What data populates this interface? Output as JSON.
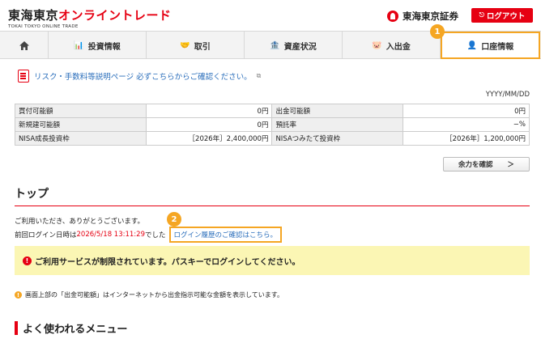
{
  "header": {
    "logo_text_black": "東海東京",
    "logo_text_red": "オンライントレード",
    "logo_sub": "TOKAI TOKYO ONLINE TRADE",
    "brand_name": "東海東京証券",
    "logout_label": "ログアウト"
  },
  "nav": {
    "items": [
      {
        "label": "",
        "icon": "home-icon"
      },
      {
        "label": "投資情報",
        "icon": "chart-icon"
      },
      {
        "label": "取引",
        "icon": "handshake-icon"
      },
      {
        "label": "資産状況",
        "icon": "building-icon"
      },
      {
        "label": "入出金",
        "icon": "piggy-bank-icon"
      },
      {
        "label": "口座情報",
        "icon": "user-icon"
      }
    ]
  },
  "badges": {
    "one": "1",
    "two": "2"
  },
  "risk": {
    "link_text": "リスク・手数料等説明ページ 必ずこちらからご確認ください。"
  },
  "date_label": "YYYY/MM/DD",
  "account": {
    "rows": [
      {
        "label1": "買付可能額",
        "value1": "0円",
        "label2": "出金可能額",
        "value2": "0円"
      },
      {
        "label1": "新規建可能額",
        "value1": "0円",
        "label2": "預託率",
        "value2": "−%"
      },
      {
        "label1": "NISA成長投資枠",
        "value1": "［2026年］2,400,000円",
        "label2": "NISAつみたて投資枠",
        "value2": "［2026年］1,200,000円"
      }
    ],
    "confirm_button": "余力を確認",
    "confirm_arrow": "＞"
  },
  "page_title": "トップ",
  "welcome": {
    "greeting": "ご利用いただき、ありがとうございます。",
    "last_login_prefix": "前回ログイン日時は",
    "last_login_datetime": "2026/5/18 13:11:29",
    "last_login_suffix": "でした",
    "history_link": "ログイン履歴のご確認はこちら。"
  },
  "warning": {
    "icon": "!",
    "text": "ご利用サービスが制限されています。パスキーでログインしてください。"
  },
  "note": {
    "icon": "!",
    "text": "画面上部の「出金可能額」はインターネットから出金指示可能な金額を表示しています。"
  },
  "menu_title": "よく使われるメニュー",
  "colors": {
    "brand_red": "#e60012",
    "highlight_orange": "#f5a623",
    "link_blue": "#2a6ebb",
    "warning_yellow": "#fbf6b4"
  }
}
